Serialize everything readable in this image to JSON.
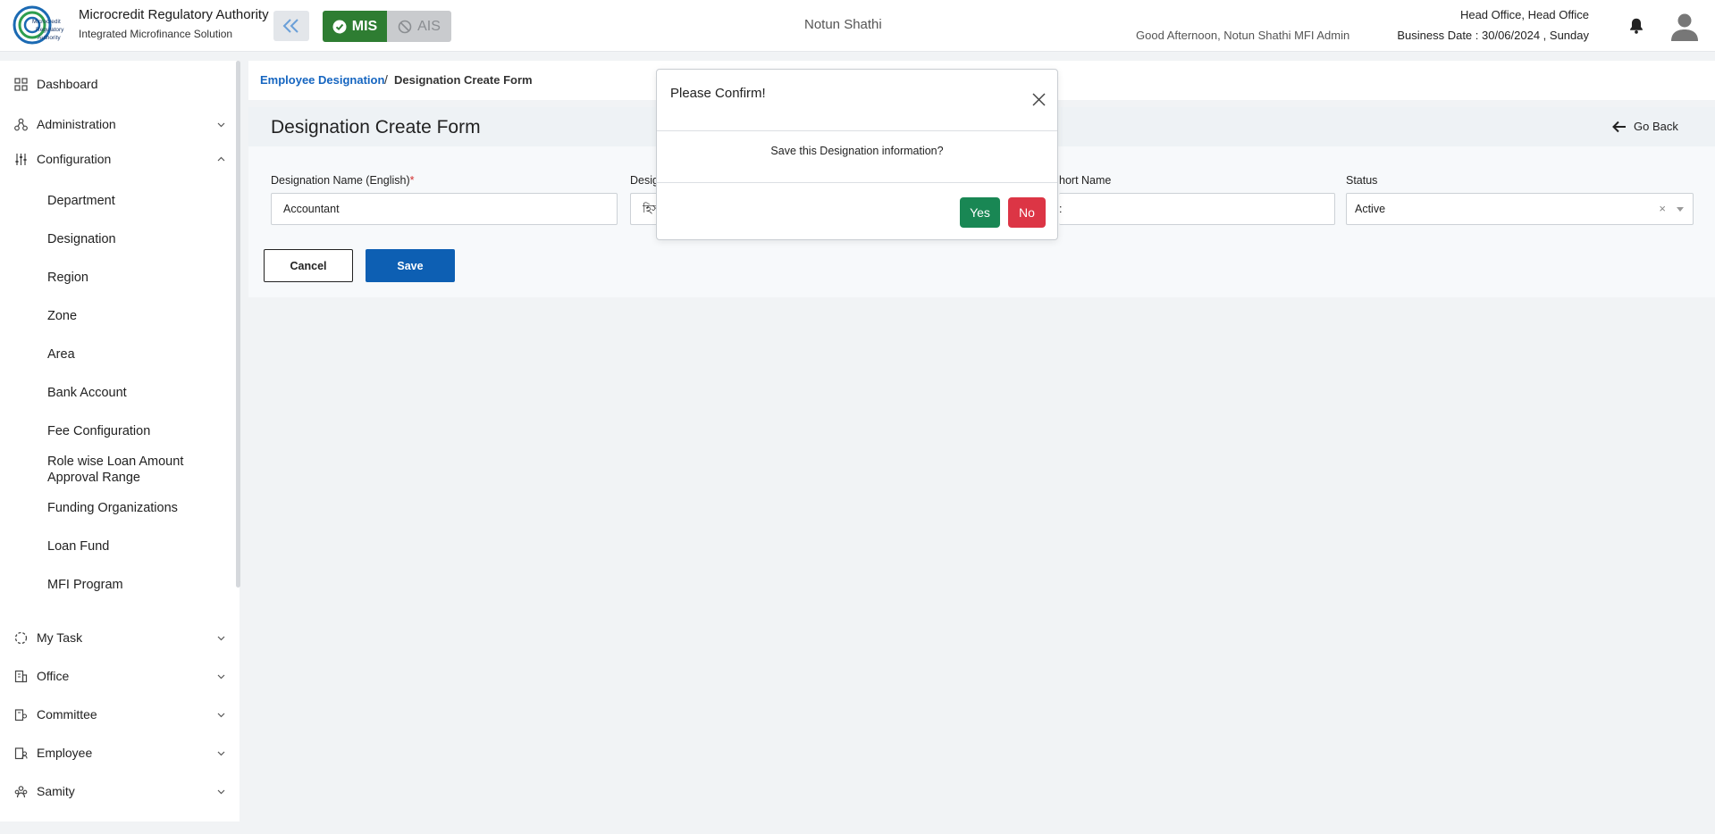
{
  "header": {
    "brand_title": "Microcredit Regulatory Authority",
    "brand_sub": "Integrated Microfinance Solution",
    "logo_text": [
      "Microcredit",
      "Regulatory",
      "Authority"
    ],
    "mode_mis": "MIS",
    "mode_ais": "AIS",
    "org_name": "Notun Shathi",
    "greeting": "Good Afternoon, Notun Shathi MFI Admin",
    "office": "Head Office, Head Office",
    "business_date": "Business Date : 30/06/2024 , Sunday"
  },
  "sidebar": {
    "dashboard": "Dashboard",
    "administration": "Administration",
    "configuration": "Configuration",
    "config_items": [
      "Department",
      "Designation",
      "Region",
      "Zone",
      "Area",
      "Bank Account",
      "Fee Configuration",
      "Role wise Loan Amount Approval Range",
      "Funding Organizations",
      "Loan Fund",
      "MFI Program"
    ],
    "my_task": "My Task",
    "office": "Office",
    "committee": "Committee",
    "employee": "Employee",
    "samity": "Samity"
  },
  "breadcrumb": {
    "parent": "Employee Designation",
    "separator": "/",
    "current": "Designation Create Form"
  },
  "form": {
    "title": "Designation Create Form",
    "go_back": "Go Back",
    "name_en_label": "Designation Name (English)",
    "required_mark": "*",
    "name_en_value": "Accountant",
    "name_bn_label_partial": "Desig",
    "name_bn_value_partial": "হিস",
    "short_name_label_partial": "hort Name",
    "short_name_value_partial": ":",
    "status_label": "Status",
    "status_value": "Active",
    "clear_glyph": "×",
    "cancel": "Cancel",
    "save": "Save"
  },
  "modal": {
    "title": "Please Confirm!",
    "message": "Save this Designation information?",
    "yes": "Yes",
    "no": "No"
  },
  "colors": {
    "mis_green": "#2e7d32",
    "save_blue": "#0d5fb3",
    "yes_green": "#198754",
    "no_red": "#dc3545",
    "link_blue": "#1565c0"
  }
}
